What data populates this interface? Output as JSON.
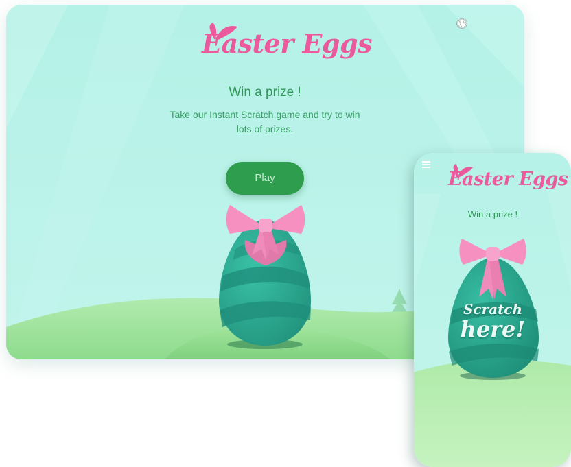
{
  "desktop": {
    "logo_text": "Easter Eggs",
    "subtitle": "Win a prize !",
    "description_line1": "Take our Instant Scratch game and try to win",
    "description_line2": "lots of prizes.",
    "play_label": "Play",
    "language_icon": "globe-icon"
  },
  "mobile": {
    "logo_text": "Easter Eggs",
    "subtitle": "Win a prize !",
    "scratch_line1": "Scratch",
    "scratch_line2": "here!",
    "menu_icon": "hamburger-icon"
  },
  "colors": {
    "sky": "#b7f2e8",
    "hill": "#a4e2a0",
    "egg": "#2eb39b",
    "egg_stripe": "#1f8e7d",
    "bow": "#f08cbb",
    "logo": "#ea5a9c",
    "button": "#2e9d4e",
    "text": "#2f9a56"
  }
}
